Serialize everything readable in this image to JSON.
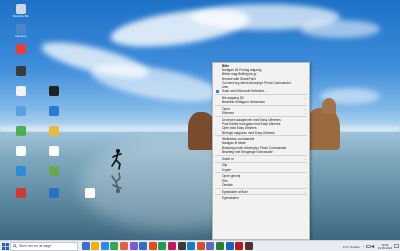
{
  "desktop": {
    "icons": [
      {
        "label": "Recycle Bin",
        "color": "#cfd8e0"
      },
      {
        "label": "Desktop",
        "color": "#4a86c8"
      },
      {
        "label": "",
        "color": "#e34234"
      },
      {
        "label": "",
        "color": "#3a3a3a"
      },
      {
        "label": "",
        "color": "#f2f2f2"
      },
      {
        "label": "",
        "color": "#5aa0e0"
      },
      {
        "label": "",
        "color": "#4caf50"
      },
      {
        "label": "",
        "color": "#ffffff"
      },
      {
        "label": "",
        "color": "#2e8bd8"
      },
      {
        "label": "",
        "color": "#d03a2a"
      },
      {
        "label": "",
        "color": "#222222"
      },
      {
        "label": "",
        "color": "#2d7ad6"
      },
      {
        "label": "",
        "color": "#e8b93a"
      },
      {
        "label": "",
        "color": "#ffffff"
      },
      {
        "label": "",
        "color": "#6aa84f"
      },
      {
        "label": "",
        "color": "#2a6fc8"
      },
      {
        "label": "",
        "color": "#ffffff"
      }
    ]
  },
  "context_menu": {
    "items": [
      {
        "label": "Bitte",
        "bold": true,
        "icon": "",
        "arrow": false
      },
      {
        "label": "Nadigan 26 Puning adgoing",
        "icon": "",
        "arrow": false
      },
      {
        "label": "Blebe mag Bidlmig ter.jp",
        "icon": "",
        "arrow": false
      },
      {
        "label": "Browse with SharePoint",
        "icon": "",
        "arrow": false
      },
      {
        "label": "Connect erg vimid Advenpiyo Photo Commander",
        "icon": "",
        "arrow": false
      },
      {
        "label": "ume",
        "icon": "",
        "arrow": false
      },
      {
        "label": "Scan med Microsoft Defender...",
        "icon": "#1e88e5",
        "arrow": false
      },
      {
        "sep": true
      },
      {
        "label": "Bib adgaing 3D",
        "icon": "",
        "arrow": true
      },
      {
        "label": "Bewidrer betfagoor velossoms",
        "icon": "",
        "arrow": false
      },
      {
        "sep": true
      },
      {
        "label": "Open",
        "icon": "",
        "arrow": true
      },
      {
        "label": "Edersen",
        "icon": "",
        "arrow": true
      },
      {
        "sep": true
      },
      {
        "label": "Unversen aaagenven med Easy Ufimmes",
        "icon": "",
        "arrow": false
      },
      {
        "label": "Post Ediher boorgaas med Easy Ufinmes",
        "icon": "",
        "arrow": false
      },
      {
        "label": "Opfn med Easy Ufinmes",
        "icon": "",
        "arrow": false
      },
      {
        "label": "Befrugs magcean med Easy Ufinmes",
        "icon": "",
        "arrow": false
      },
      {
        "sep": true
      },
      {
        "label": "Weliebeac commanest",
        "icon": "",
        "arrow": true
      },
      {
        "label": "Nadigan til beste",
        "icon": "",
        "arrow": false
      },
      {
        "label": "Bnsbeag mosh Advenpiyo Photo Commander",
        "icon": "",
        "arrow": false
      },
      {
        "label": "Bearbeg met Seogesge Videostusie",
        "icon": "",
        "arrow": false
      },
      {
        "sep": true
      },
      {
        "label": "Sabel or",
        "icon": "",
        "arrow": true
      },
      {
        "sep": true
      },
      {
        "label": "Klip",
        "icon": "",
        "arrow": false
      },
      {
        "label": "Kopier",
        "icon": "",
        "arrow": false
      },
      {
        "sep": true
      },
      {
        "label": "Opret genvej",
        "icon": "",
        "arrow": false
      },
      {
        "label": "Slet",
        "icon": "",
        "arrow": false
      },
      {
        "label": "Omdøb",
        "icon": "",
        "arrow": false
      },
      {
        "sep": true
      },
      {
        "label": "Egnskaber at fiser",
        "icon": "",
        "arrow": true
      },
      {
        "sep": true
      },
      {
        "label": "Egenskaber",
        "icon": "",
        "arrow": false
      }
    ]
  },
  "taskbar": {
    "search_placeholder": "Skriv her for at søge",
    "apps": [
      "#3b6fd6",
      "#f0b400",
      "#2f89e8",
      "#35a853",
      "#e2603c",
      "#7a5ad8",
      "#2c6fcf",
      "#e64a19",
      "#1f9d55",
      "#c2185b",
      "#3a3a3a",
      "#0f7dd6",
      "#d94c2a",
      "#5c6bc0",
      "#2e7d32",
      "#1565c0",
      "#b71c1c",
      "#4e342e"
    ],
    "weather": "11°C Solskin",
    "time": "10:30",
    "date": "13-05-2024"
  }
}
